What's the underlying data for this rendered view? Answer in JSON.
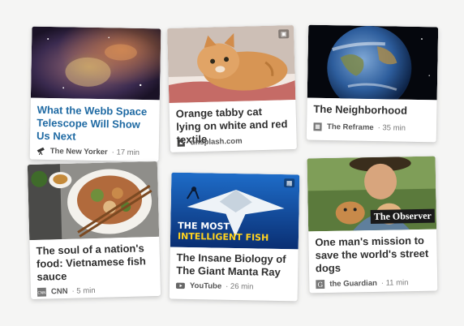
{
  "cards": [
    {
      "title": "What the Webb Space Telescope Will Show Us Next",
      "source": "The New Yorker",
      "duration": "17 min",
      "source_icon": "telescope-icon"
    },
    {
      "title": "Orange tabby cat lying on white and red textile",
      "source": "unsplash.com",
      "duration": "",
      "source_icon": "unsplash-icon",
      "badge_icon": "image-icon"
    },
    {
      "title": "The Neighborhood",
      "source": "The Reframe",
      "duration": "35 min",
      "source_icon": "reframe-icon"
    },
    {
      "title": "The soul of a nation's food: Vietnamese fish sauce",
      "source": "CNN",
      "duration": "5 min",
      "source_icon": "cnn-icon"
    },
    {
      "title": "The Insane Biology of The Giant Manta Ray",
      "source": "YouTube",
      "duration": "26 min",
      "source_icon": "youtube-icon",
      "badge_icon": "video-icon",
      "overlay_line1": "THE MOST",
      "overlay_line2": "INTELLIGENT FISH"
    },
    {
      "title": "One man's mission to save the world's street dogs",
      "source": "the Guardian",
      "duration": "11 min",
      "source_icon": "guardian-icon",
      "overlay_brand": "The Observer"
    }
  ],
  "colors": {
    "link_title": "#1f6aa3",
    "title": "#2f2f2f",
    "meta": "#6e6e6e",
    "background": "#f5f5f4"
  }
}
